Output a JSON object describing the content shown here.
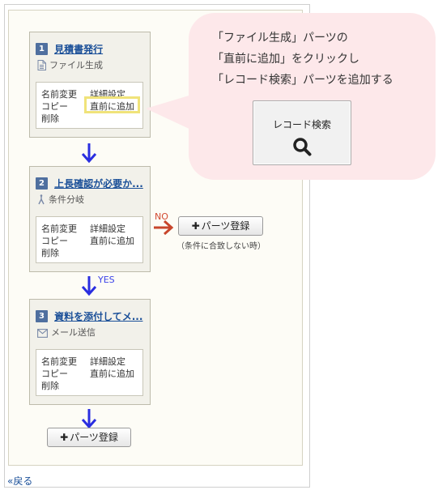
{
  "workflow": {
    "steps": [
      {
        "number": "1",
        "title": "見積書発行",
        "subtitle": "ファイル生成",
        "icon": "file-icon"
      },
      {
        "number": "2",
        "title": "上長確認が必要か...",
        "subtitle": "条件分岐",
        "icon": "branch-icon"
      },
      {
        "number": "3",
        "title": "資料を添付してメ...",
        "subtitle": "メール送信",
        "icon": "mail-icon"
      }
    ],
    "menu": {
      "rename": "名前変更",
      "detail": "詳細設定",
      "copy": "コピー",
      "add_before": "直前に追加",
      "delete": "削除"
    },
    "branch_no_label": "NO",
    "branch_yes_label": "YES",
    "register_label": "パーツ登録",
    "register_plus": "✚",
    "branch_note": "（条件に合致しない時）",
    "back_label": "«戻る"
  },
  "callout": {
    "lines": [
      "「ファイル生成」パーツの",
      "「直前に追加」をクリックし",
      "「レコード検索」パーツを追加する"
    ],
    "tile_label": "レコード検索",
    "tile_icon": "search-icon"
  },
  "colors": {
    "arrow_blue": "#2a2ee0",
    "arrow_red": "#c8462c",
    "highlight": "#f0e37a",
    "bubble": "#fde8ea",
    "link": "#1a4f98"
  }
}
